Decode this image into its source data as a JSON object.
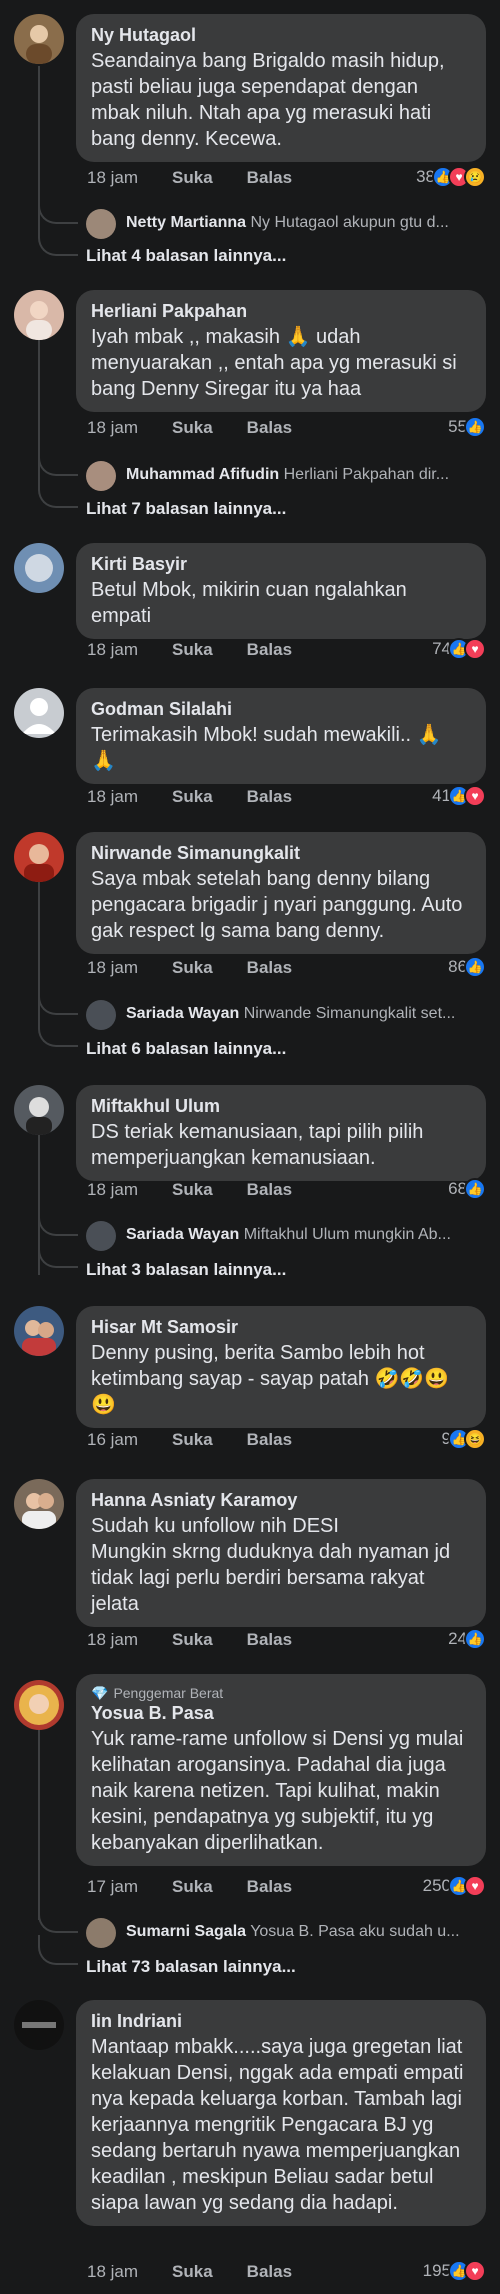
{
  "comments": [
    {
      "author": "Ny Hutagaol",
      "text": "Seandainya bang Brigaldo masih hidup, pasti beliau juga sependapat dengan mbak niluh. Ntah apa yg merasuki hati bang denny. Kecewa.",
      "time": "18 jam",
      "like": "Suka",
      "reply": "Balas",
      "count": "38",
      "reactions": [
        "like",
        "love",
        "sad"
      ],
      "reply_preview": {
        "author": "Netty Martianna",
        "text": "Ny Hutagaol akupun gtu d..."
      },
      "more": "Lihat 4 balasan lainnya...",
      "avatar_color": "#8a6d4b"
    },
    {
      "author": "Herliani Pakpahan",
      "text": "Iyah mbak ,, makasih 🙏 udah menyuarakan ,, entah apa yg merasuki si bang Denny Siregar itu ya haa",
      "time": "18 jam",
      "like": "Suka",
      "reply": "Balas",
      "count": "55",
      "reactions": [
        "like"
      ],
      "reply_preview": {
        "author": "Muhammad Afifudin",
        "text": "Herliani Pakpahan dir..."
      },
      "more": "Lihat 7 balasan lainnya...",
      "avatar_color": "#d9b8a8"
    },
    {
      "author": "Kirti Basyir",
      "text": "Betul Mbok, mikirin cuan ngalahkan empati",
      "time": "18 jam",
      "like": "Suka",
      "reply": "Balas",
      "count": "74",
      "reactions": [
        "like",
        "love"
      ],
      "avatar_color": "#6f8fb3"
    },
    {
      "author": "Godman Silalahi",
      "text": "Terimakasih Mbok! sudah mewakili.. 🙏 🙏",
      "time": "18 jam",
      "like": "Suka",
      "reply": "Balas",
      "count": "41",
      "reactions": [
        "like",
        "love"
      ],
      "avatar_color": "#c8ccd1"
    },
    {
      "author": "Nirwande Simanungkalit",
      "text": "Saya mbak setelah bang denny bilang pengacara brigadir j nyari panggung. Auto gak respect lg sama bang denny.",
      "time": "18 jam",
      "like": "Suka",
      "reply": "Balas",
      "count": "86",
      "reactions": [
        "like"
      ],
      "reply_preview": {
        "author": "Sariada Wayan",
        "text": "Nirwande Simanungkalit set..."
      },
      "more": "Lihat 6 balasan lainnya...",
      "avatar_color": "#c0392b"
    },
    {
      "author": "Miftakhul Ulum",
      "text": "DS teriak kemanusiaan, tapi pilih pilih memperjuangkan kemanusiaan.",
      "time": "18 jam",
      "like": "Suka",
      "reply": "Balas",
      "count": "68",
      "reactions": [
        "like"
      ],
      "reply_preview": {
        "author": "Sariada Wayan",
        "text": "Miftakhul Ulum mungkin Ab..."
      },
      "more": "Lihat 3 balasan lainnya...",
      "avatar_color": "#555a60"
    },
    {
      "author": "Hisar Mt Samosir",
      "text": "Denny pusing, berita Sambo lebih hot ketimbang sayap - sayap patah 🤣🤣😃 😃",
      "time": "16 jam",
      "like": "Suka",
      "reply": "Balas",
      "count": "9",
      "reactions": [
        "like",
        "haha"
      ],
      "avatar_color": "#3d5a80"
    },
    {
      "author": "Hanna Asniaty Karamoy",
      "text": "Sudah ku unfollow nih DESI\nMungkin skrng duduknya dah nyaman jd tidak lagi perlu berdiri bersama rakyat jelata",
      "time": "18 jam",
      "like": "Suka",
      "reply": "Balas",
      "count": "24",
      "reactions": [
        "like"
      ],
      "avatar_color": "#7a6a5a"
    },
    {
      "badge": "Penggemar Berat",
      "author": "Yosua B. Pasa",
      "text": "Yuk rame-rame unfollow si Densi yg mulai kelihatan arogansinya. Padahal dia juga naik karena netizen. Tapi kulihat, makin kesini, pendapatnya yg subjektif, itu yg kebanyakan diperlihatkan.",
      "time": "17 jam",
      "like": "Suka",
      "reply": "Balas",
      "count": "250",
      "reactions": [
        "like",
        "love"
      ],
      "reply_preview": {
        "author": "Sumarni Sagala",
        "text": "Yosua B. Pasa aku sudah u..."
      },
      "more": "Lihat 73 balasan lainnya...",
      "avatar_color": "#b03a2e"
    },
    {
      "author": "Iin Indriani",
      "text": "Mantaap mbakk.....saya juga gregetan liat kelakuan Densi, nggak ada empati empati nya kepada keluarga korban. Tambah lagi kerjaannya mengritik Pengacara BJ yg sedang bertaruh nyawa memperjuangkan keadilan , meskipun Beliau sadar betul siapa lawan yg sedang dia hadapi.",
      "time": "18 jam",
      "like": "Suka",
      "reply": "Balas",
      "count": "195",
      "reactions": [
        "like",
        "love"
      ],
      "avatar_color": "#111111"
    }
  ]
}
